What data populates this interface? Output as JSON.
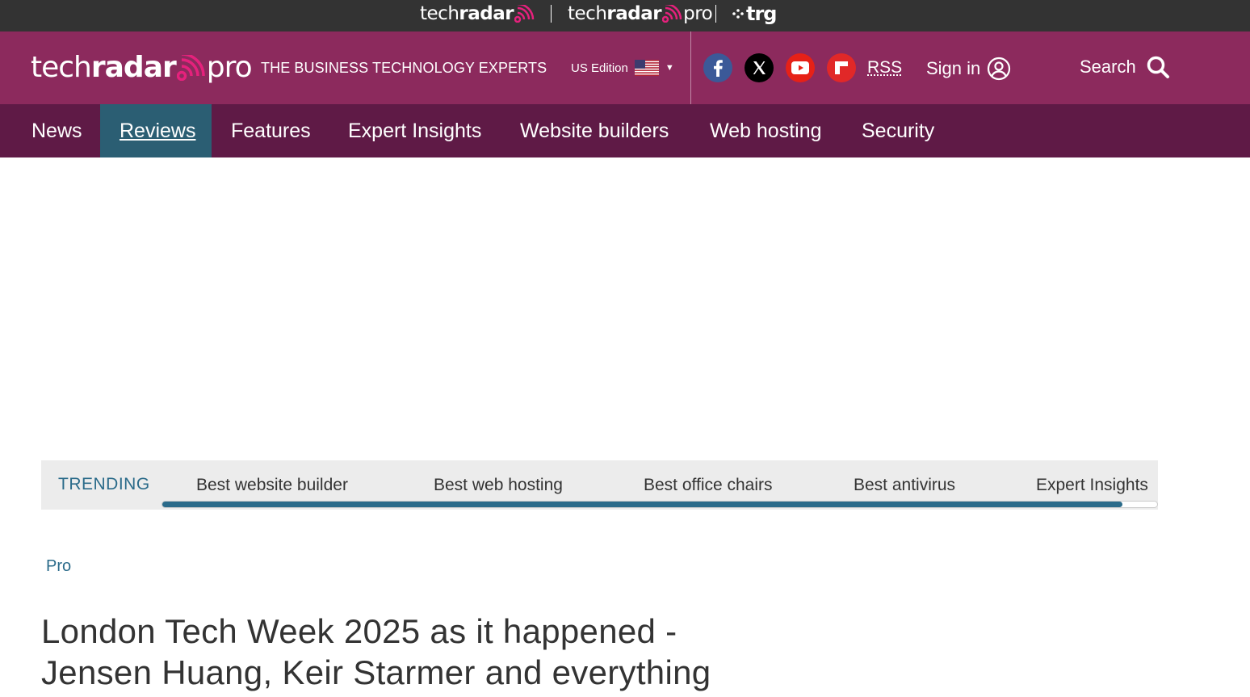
{
  "brand_strip": {
    "techradar": {
      "tech": "tech",
      "radar": "radar"
    },
    "techradar_pro": {
      "tech": "tech",
      "radar": "radar",
      "pro": "pro"
    },
    "trg": "trg"
  },
  "header": {
    "logo": {
      "tech": "tech",
      "radar": "radar",
      "pro": "pro"
    },
    "tagline": "THE BUSINESS TECHNOLOGY EXPERTS",
    "edition": "US Edition",
    "rss": "RSS",
    "sign_in": "Sign in",
    "search": "Search",
    "social_icons": [
      "facebook-icon",
      "x-icon",
      "youtube-icon",
      "flipboard-icon"
    ]
  },
  "nav": {
    "items": [
      {
        "label": "News"
      },
      {
        "label": "Reviews",
        "active": true
      },
      {
        "label": "Features"
      },
      {
        "label": "Expert Insights"
      },
      {
        "label": "Website builders"
      },
      {
        "label": "Web hosting"
      },
      {
        "label": "Security"
      }
    ]
  },
  "trending": {
    "label": "TRENDING",
    "links": [
      "Best website builder",
      "Best web hosting",
      "Best office chairs",
      "Best antivirus",
      "Expert Insights"
    ],
    "scroll_progress": 0.965
  },
  "article": {
    "breadcrumb": "Pro",
    "headline_line1": "London Tech Week 2025 as it happened -",
    "headline_line2": "Jensen Huang, Keir Starmer and everything"
  },
  "colors": {
    "brand_strip": "#333333",
    "header": "#8c2a5d",
    "nav": "#5f1a46",
    "nav_active": "#2b5e73",
    "accent_pink": "#e5217c",
    "link_blue": "#2b6b8a"
  }
}
